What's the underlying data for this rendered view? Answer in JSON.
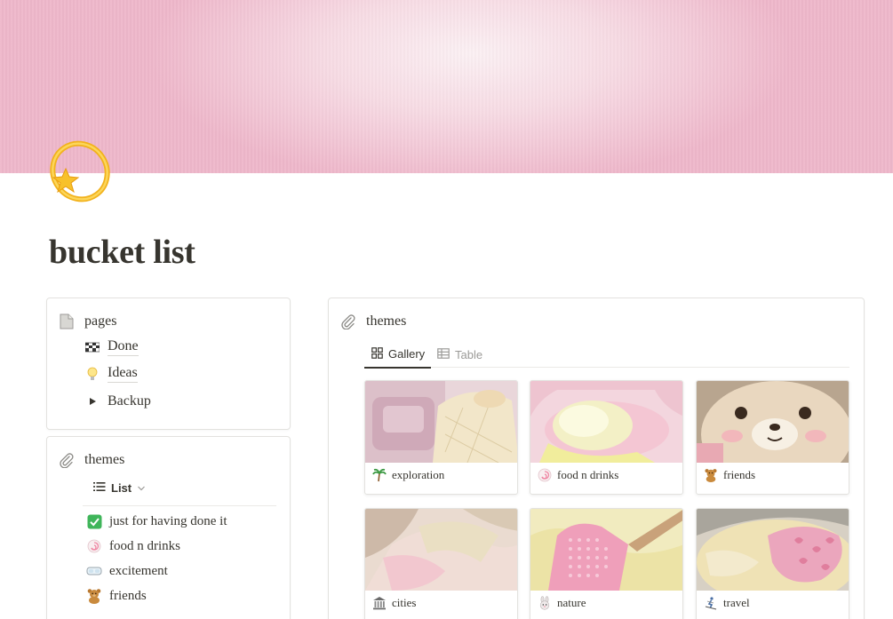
{
  "page": {
    "title": "bucket list",
    "icon": "dizzy-star-icon"
  },
  "pages_block": {
    "heading": "pages",
    "items": [
      {
        "label": "Done",
        "icon": "checkered-flag-icon"
      },
      {
        "label": "Ideas",
        "icon": "light-bulb-icon"
      },
      {
        "label": "Backup",
        "icon": "toggle-arrow-icon"
      }
    ]
  },
  "themes_left": {
    "heading": "themes",
    "view_label": "List",
    "items": [
      {
        "label": "just for having done it",
        "icon": "check-mark-icon"
      },
      {
        "label": "food n drinks",
        "icon": "fish-cake-icon"
      },
      {
        "label": "excitement",
        "icon": "goggles-icon"
      },
      {
        "label": "friends",
        "icon": "teddy-bear-icon"
      }
    ]
  },
  "themes_main": {
    "heading": "themes",
    "tabs": [
      {
        "label": "Gallery",
        "active": true
      },
      {
        "label": "Table",
        "active": false
      }
    ],
    "cards": [
      {
        "label": "exploration",
        "icon": "palm-tree-icon"
      },
      {
        "label": "food n drinks",
        "icon": "fish-cake-icon"
      },
      {
        "label": "friends",
        "icon": "teddy-bear-icon"
      },
      {
        "label": "cities",
        "icon": "classical-building-icon"
      },
      {
        "label": "nature",
        "icon": "rabbit-icon"
      },
      {
        "label": "travel",
        "icon": "skier-icon"
      }
    ]
  },
  "colors": {
    "text": "#37352f",
    "muted": "#9b9a97",
    "cover_pink": "#eeb7ca",
    "border": "#e3e2df"
  }
}
